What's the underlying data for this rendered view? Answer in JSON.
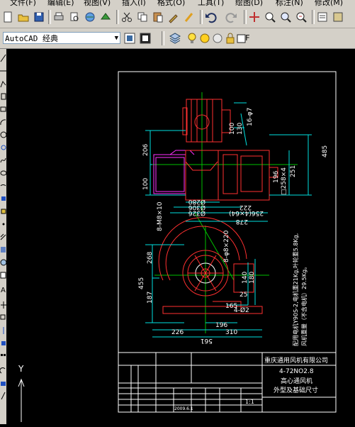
{
  "menu": {
    "items": [
      "文件(F)",
      "编辑(E)",
      "视图(V)",
      "插入(I)",
      "格式(O)",
      "工具(T)",
      "绘图(D)",
      "标注(N)",
      "修改(M)"
    ]
  },
  "workspace": {
    "selected": "AutoCAD 经典"
  },
  "layer": {
    "name": "F"
  },
  "drawing": {
    "dimensions": {
      "d206": "206",
      "d100_left": "100",
      "d100_top": "100",
      "d130": "130",
      "d16_7": "16-φ7",
      "d485": "485",
      "d251": "251",
      "d196": "196",
      "d258": "□258×4",
      "d280": "Ø280",
      "d306": "Ø306",
      "d326": "Ø326",
      "d222": "222",
      "d256": "256(4×64)",
      "d278": "278",
      "d8m8": "8-M8×10",
      "d268": "268",
      "d455": "455",
      "d187": "187",
      "d140": "140",
      "d180": "180",
      "d25": "25",
      "d4_2": "4-Ø2",
      "d165": "165",
      "d226": "226",
      "d310": "310",
      "d196b": "196",
      "d561": "561",
      "d8_220": "8-φ8×220"
    },
    "notes": {
      "line1": "配用电机Y90S-2,电机重21Kg,叶轮重5.8Kg,",
      "line2": "风机重量（不含电机）29.5Kg。"
    },
    "title_block": {
      "company": "重庆通用风机有限公司",
      "model": "4-72NO2.8",
      "name": "高心通风机",
      "subtitle": "外型及基础尺寸",
      "scale": "1:1",
      "date": "2009.6.1"
    },
    "ucs": {
      "y": "Y"
    }
  }
}
